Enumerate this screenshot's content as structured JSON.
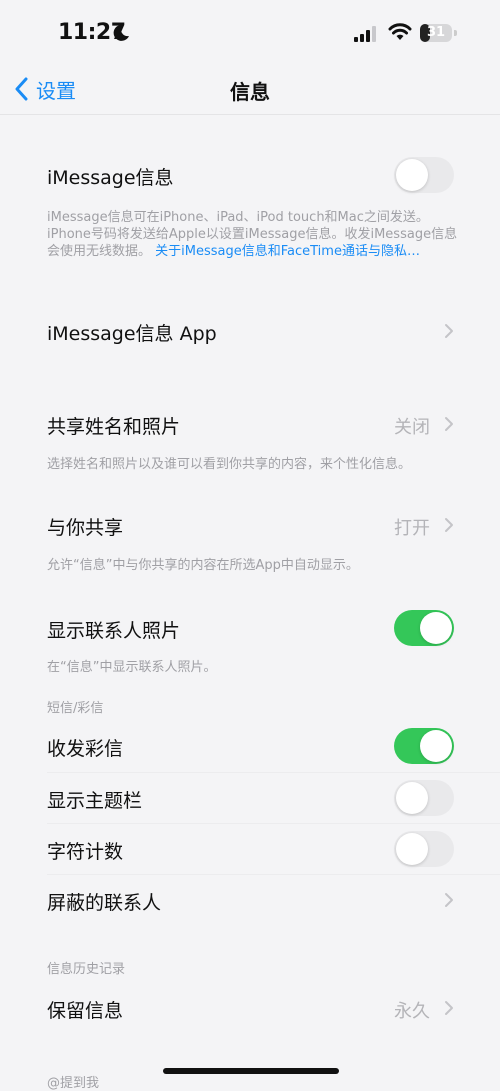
{
  "status_bar": {
    "time": "11:27",
    "battery": "31",
    "battery_level": 0.31
  },
  "nav": {
    "back_label": "设置",
    "title": "信息"
  },
  "imessage": {
    "label": "iMessage信息",
    "toggle_on": false,
    "footer": "iMessage信息可在iPhone、iPad、iPod touch和Mac之间发送。iPhone号码将发送给Apple以设置iMessage信息。收发iMessage信息会使用无线数据。",
    "footer_link": "关于iMessage信息和FaceTime通话与隐私…"
  },
  "imessage_apps": {
    "label": "iMessage信息 App"
  },
  "share_name": {
    "label": "共享姓名和照片",
    "value": "关闭",
    "footer": "选择姓名和照片以及谁可以看到你共享的内容，来个性化信息。"
  },
  "shared_with_you": {
    "label": "与你共享",
    "value": "打开",
    "footer": "允许“信息”中与你共享的内容在所选App中自动显示。"
  },
  "contact_photos": {
    "label": "显示联系人照片",
    "toggle_on": true,
    "footer": "在“信息”中显示联系人照片。"
  },
  "sms_mms": {
    "header": "短信/彩信",
    "mms": {
      "label": "收发彩信",
      "toggle_on": true
    },
    "subject": {
      "label": "显示主题栏",
      "toggle_on": false
    },
    "char_count": {
      "label": "字符计数",
      "toggle_on": false
    },
    "blocked": {
      "label": "屏蔽的联系人"
    }
  },
  "history": {
    "header": "信息历史记录",
    "keep": {
      "label": "保留信息",
      "value": "永久"
    }
  },
  "mentions": {
    "header": "@提到我"
  },
  "colors": {
    "accent": "#1a8cf5",
    "toggle_on": "#34c759",
    "toggle_off": "#e9e9eb",
    "secondary_text": "#a0a0a5"
  }
}
